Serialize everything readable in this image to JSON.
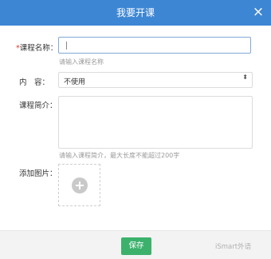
{
  "dialog": {
    "title": "我要开课",
    "close_icon": "×"
  },
  "form": {
    "course_name": {
      "required_mark": "*",
      "label": "课程名称：",
      "value": "",
      "hint": "请输入课程名称"
    },
    "content": {
      "label": "内　容：",
      "selected": "不使用",
      "arrow": "⬍"
    },
    "intro": {
      "label": "课程简介：",
      "value": "",
      "hint": "请输入课程简介，最大长度不能超过200字"
    },
    "image": {
      "label": "添加图片：",
      "icon": "plus-icon"
    }
  },
  "footer": {
    "save_label": "保存",
    "watermark": "iSmart外语"
  }
}
